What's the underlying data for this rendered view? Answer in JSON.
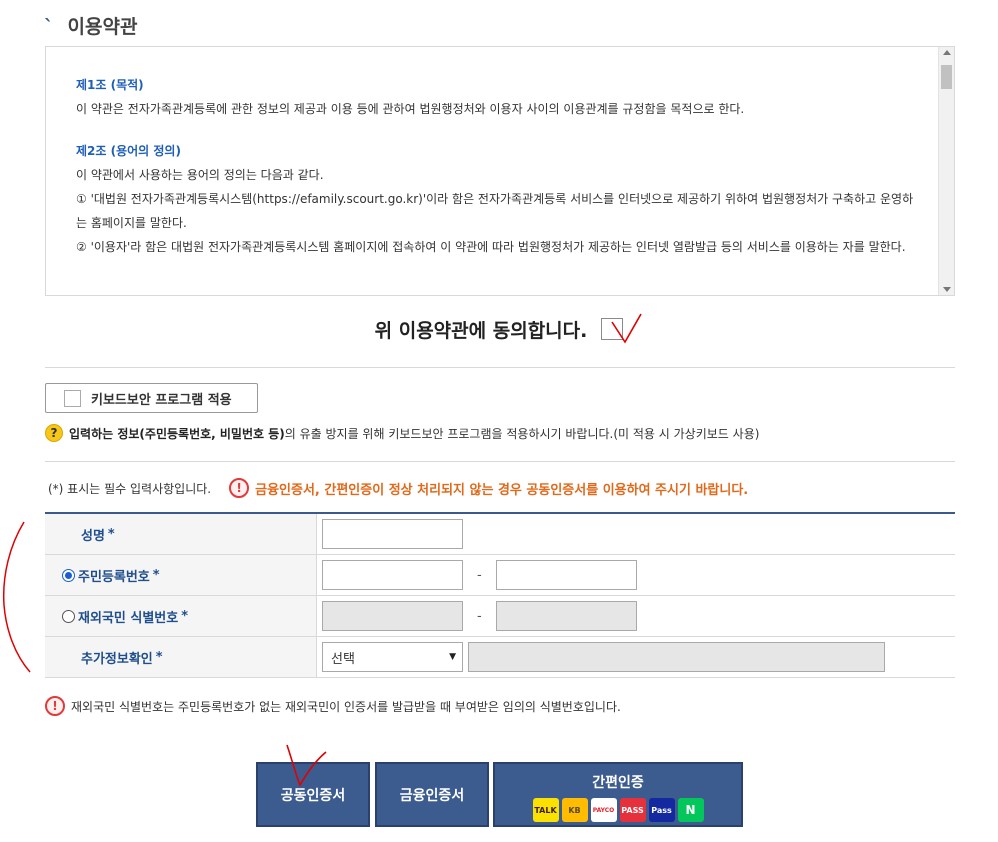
{
  "section": {
    "title": "이용약관"
  },
  "terms": {
    "art1_title": "제1조 (목적)",
    "art1_body": "이 약관은 전자가족관계등록에 관한 정보의 제공과 이용 등에 관하여 법원행정처와 이용자 사이의 이용관계를 규정함을 목적으로 한다.",
    "art2_title": "제2조 (용어의 정의)",
    "art2_intro": "이 약관에서 사용하는 용어의 정의는 다음과 같다.",
    "art2_item1": "① '대법원 전자가족관계등록시스템(https://efamily.scourt.go.kr)'이라 함은 전자가족관계등록 서비스를 인터넷으로 제공하기 위하여 법원행정처가 구축하고 운영하는 홈페이지를 말한다.",
    "art2_item2": "② '이용자'라 함은 대법원 전자가족관계등록시스템 홈페이지에 접속하여 이 약관에 따라 법원행정처가 제공하는 인터넷 열람발급 등의 서비스를 이용하는 자를 말한다."
  },
  "agree": {
    "label": "위 이용약관에 동의합니다."
  },
  "keyboard": {
    "button_label": "키보드보안 프로그램 적용",
    "help_icon": "?",
    "help_bold": "입력하는 정보(주민등록번호, 비밀번호 등)",
    "help_rest": "의 유출 방지를 위해 키보드보안 프로그램을 적용하시기 바랍니다.(미 적용 시 가상키보드 사용)"
  },
  "required": {
    "note": "(*) 표시는 필수 입력사항입니다.",
    "warn_icon": "!",
    "warning": "금융인증서, 간편인증이 정상 처리되지 않는 경우 공동인증서를 이용하여 주시기 바랍니다."
  },
  "form": {
    "name_label": "성명",
    "rrn_label": "주민등록번호",
    "foreign_label": "재외국민 식별번호",
    "extra_label": "추가정보확인",
    "star": "*",
    "dash": "-",
    "select_value": "선택"
  },
  "note": {
    "icon": "!",
    "text": "재외국민 식별번호는 주민등록번호가 없는 재외국민이 인증서를 발급받을 때 부여받은 임의의 식별번호입니다."
  },
  "buttons": {
    "gongdong": "공동인증서",
    "geumyung": "금융인증서",
    "ganpyeon": "간편인증",
    "logos": [
      "TALK",
      "KB",
      "PAYCO",
      "PASS",
      "Pass",
      "N"
    ]
  },
  "colors": {
    "primary": "#3c5b8e",
    "warning": "#e06a1b",
    "link": "#1f5fb8",
    "annotation": "#e00000"
  }
}
